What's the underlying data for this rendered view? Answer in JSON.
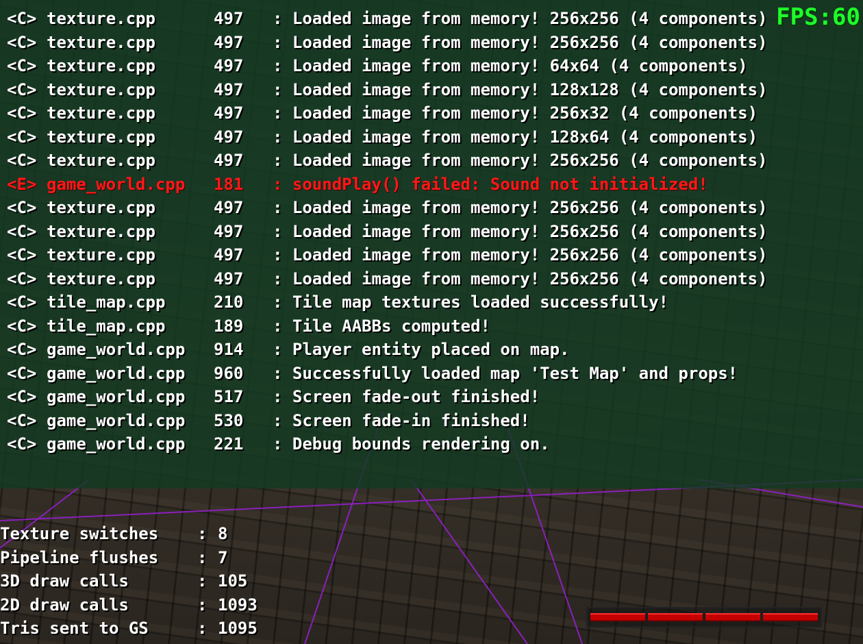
{
  "hud": {
    "fps_text": "FPS:60"
  },
  "console": {
    "lines": [
      {
        "tag": "<C>",
        "file": "texture.cpp",
        "line": "497",
        "msg": "Loaded image from memory! 256x256 (4 components)",
        "level": "info"
      },
      {
        "tag": "<C>",
        "file": "texture.cpp",
        "line": "497",
        "msg": "Loaded image from memory! 256x256 (4 components)",
        "level": "info"
      },
      {
        "tag": "<C>",
        "file": "texture.cpp",
        "line": "497",
        "msg": "Loaded image from memory! 64x64 (4 components)",
        "level": "info"
      },
      {
        "tag": "<C>",
        "file": "texture.cpp",
        "line": "497",
        "msg": "Loaded image from memory! 128x128 (4 components)",
        "level": "info"
      },
      {
        "tag": "<C>",
        "file": "texture.cpp",
        "line": "497",
        "msg": "Loaded image from memory! 256x32 (4 components)",
        "level": "info"
      },
      {
        "tag": "<C>",
        "file": "texture.cpp",
        "line": "497",
        "msg": "Loaded image from memory! 128x64 (4 components)",
        "level": "info"
      },
      {
        "tag": "<C>",
        "file": "texture.cpp",
        "line": "497",
        "msg": "Loaded image from memory! 256x256 (4 components)",
        "level": "info"
      },
      {
        "tag": "<E>",
        "file": "game_world.cpp",
        "line": "181",
        "msg": "soundPlay() failed: Sound not initialized!",
        "level": "error"
      },
      {
        "tag": "<C>",
        "file": "texture.cpp",
        "line": "497",
        "msg": "Loaded image from memory! 256x256 (4 components)",
        "level": "info"
      },
      {
        "tag": "<C>",
        "file": "texture.cpp",
        "line": "497",
        "msg": "Loaded image from memory! 256x256 (4 components)",
        "level": "info"
      },
      {
        "tag": "<C>",
        "file": "texture.cpp",
        "line": "497",
        "msg": "Loaded image from memory! 256x256 (4 components)",
        "level": "info"
      },
      {
        "tag": "<C>",
        "file": "texture.cpp",
        "line": "497",
        "msg": "Loaded image from memory! 256x256 (4 components)",
        "level": "info"
      },
      {
        "tag": "<C>",
        "file": "tile_map.cpp",
        "line": "210",
        "msg": "Tile map textures loaded successfully!",
        "level": "info"
      },
      {
        "tag": "<C>",
        "file": "tile_map.cpp",
        "line": "189",
        "msg": "Tile AABBs computed!",
        "level": "info"
      },
      {
        "tag": "<C>",
        "file": "game_world.cpp",
        "line": "914",
        "msg": "Player entity placed on map.",
        "level": "info"
      },
      {
        "tag": "<C>",
        "file": "game_world.cpp",
        "line": "960",
        "msg": "Successfully loaded map 'Test Map' and props!",
        "level": "info"
      },
      {
        "tag": "<C>",
        "file": "game_world.cpp",
        "line": "517",
        "msg": "Screen fade-out finished!",
        "level": "info"
      },
      {
        "tag": "<C>",
        "file": "game_world.cpp",
        "line": "530",
        "msg": "Screen fade-in finished!",
        "level": "info"
      },
      {
        "tag": "<C>",
        "file": "game_world.cpp",
        "line": "221",
        "msg": "Debug bounds rendering on.",
        "level": "info"
      }
    ]
  },
  "stats": [
    {
      "label": "Texture switches",
      "value": "8"
    },
    {
      "label": "Pipeline flushes",
      "value": "7"
    },
    {
      "label": "3D draw calls",
      "value": "105"
    },
    {
      "label": "2D draw calls",
      "value": "1093"
    },
    {
      "label": "Tris sent to GS",
      "value": "1095"
    }
  ],
  "health_bar": {
    "segments": 4,
    "fill_fraction": 1.0,
    "color": "#c40000"
  },
  "colors": {
    "info_text": "#ffffff",
    "error_text": "#ff1818",
    "fps_text": "#1eff2a",
    "console_bg": "#123a22"
  }
}
